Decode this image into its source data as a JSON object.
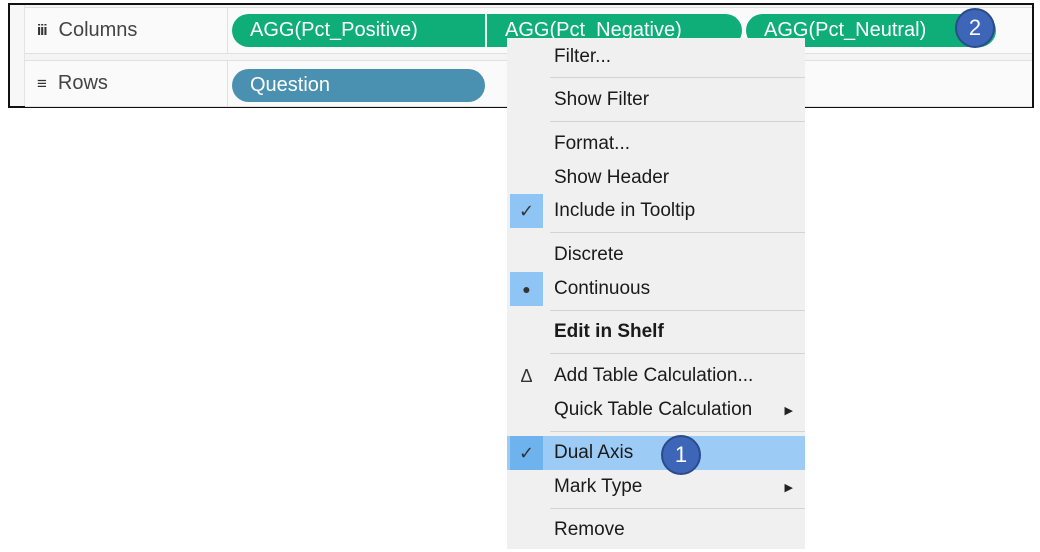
{
  "shelves": {
    "columns": {
      "label": "Columns",
      "icon": "columns-icon",
      "icon_glyph": "iii",
      "pills": [
        {
          "label": "AGG(Pct_Positive)",
          "color": "#0fad78"
        },
        {
          "label": "AGG(Pct_Negative)",
          "color": "#0fad78"
        },
        {
          "label": "AGG(Pct_Neutral)",
          "color": "#0fad78"
        }
      ]
    },
    "rows": {
      "label": "Rows",
      "icon": "rows-icon",
      "icon_glyph": "≡",
      "pills": [
        {
          "label": "Question",
          "color": "#4a91b1"
        }
      ]
    }
  },
  "context_menu": {
    "items": [
      {
        "label": "Filter..."
      },
      {
        "label": "Show Filter"
      },
      {
        "label": "Format..."
      },
      {
        "label": "Show Header"
      },
      {
        "label": "Include in Tooltip",
        "checked": true,
        "icon_glyph": "✓"
      },
      {
        "label": "Discrete"
      },
      {
        "label": "Continuous",
        "selected": true,
        "icon_glyph": "●"
      },
      {
        "label": "Edit in Shelf",
        "bold": true
      },
      {
        "label": "Add Table Calculation...",
        "icon_glyph": "Δ"
      },
      {
        "label": "Quick Table Calculation",
        "submenu": true,
        "arrow_glyph": "▶"
      },
      {
        "label": "Dual Axis",
        "checked": true,
        "highlighted": true,
        "icon_glyph": "✓"
      },
      {
        "label": "Mark Type",
        "submenu": true,
        "arrow_glyph": "▶"
      },
      {
        "label": "Remove"
      }
    ]
  },
  "annotations": {
    "badge_1": "1",
    "badge_2": "2",
    "badge_color": "#3d66b8"
  }
}
